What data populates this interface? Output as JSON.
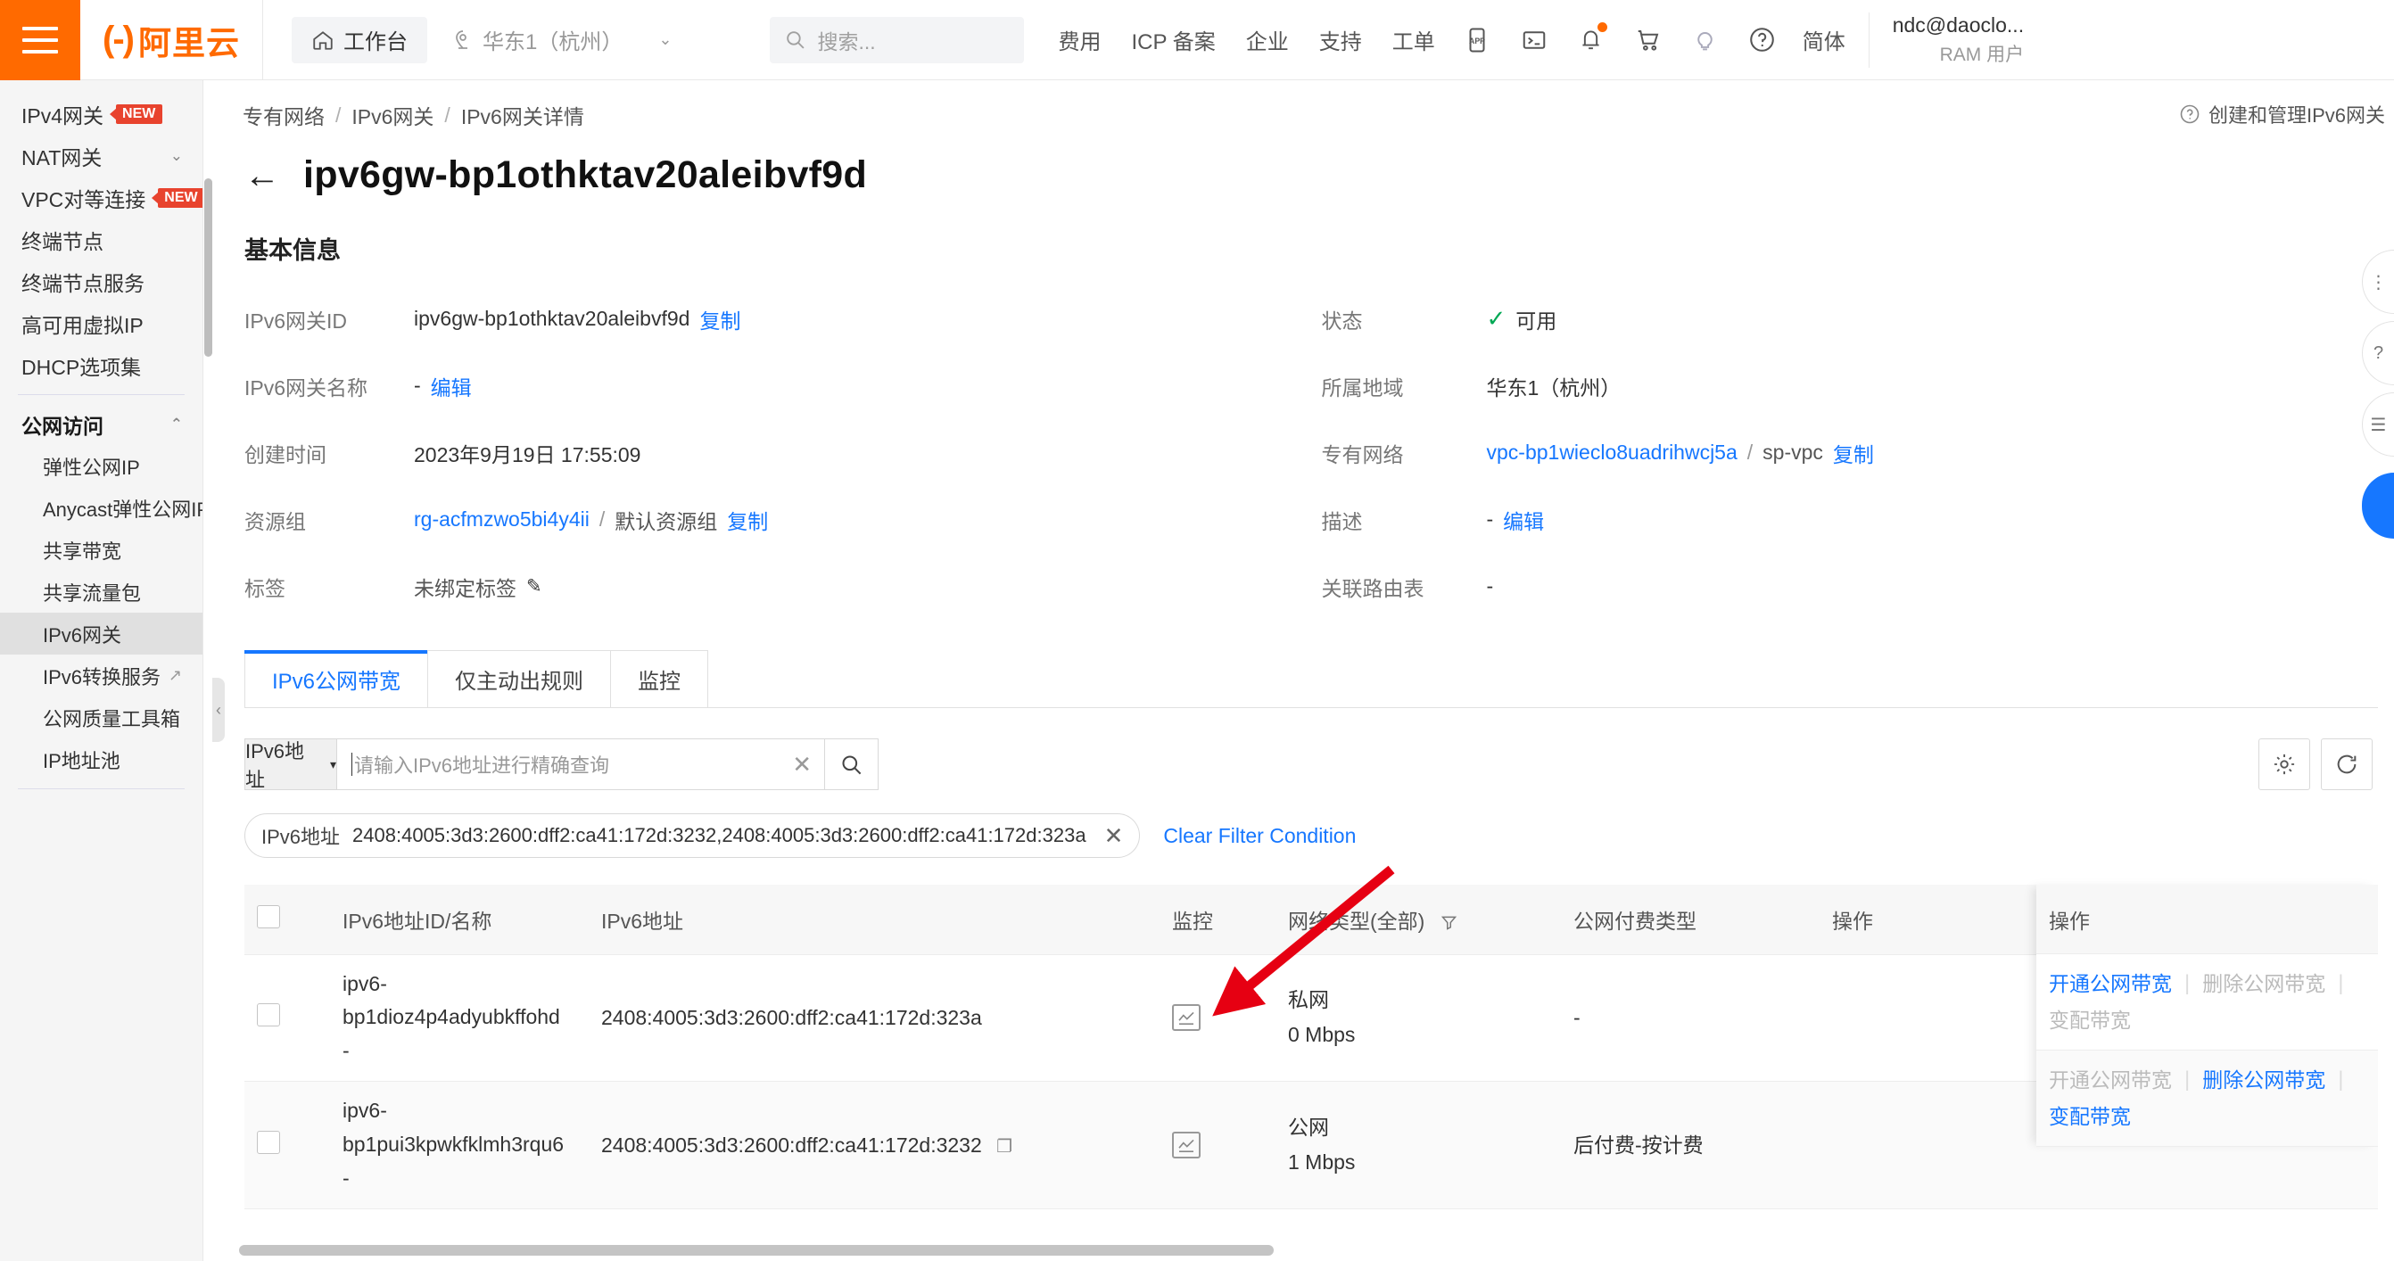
{
  "header": {
    "logo_text": "阿里云",
    "workbench": "工作台",
    "region": "华东1（杭州）",
    "search_placeholder": "搜索...",
    "nav_links": [
      "费用",
      "ICP 备案",
      "企业",
      "支持",
      "工单"
    ],
    "icons": [
      "app-icon",
      "terminal-icon",
      "bell-icon",
      "cart-icon",
      "lightbulb-icon",
      "help-icon"
    ],
    "lang": "简体",
    "user_name": "ndc@daoclo...",
    "user_role": "RAM 用户"
  },
  "sidebar": {
    "items": [
      {
        "label": "IPv4网关",
        "badge": "NEW",
        "level": "top"
      },
      {
        "label": "NAT网关",
        "chevron": "⌄",
        "level": "top"
      },
      {
        "label": "VPC对等连接",
        "badge": "NEW",
        "level": "top"
      },
      {
        "label": "终端节点",
        "level": "top"
      },
      {
        "label": "终端节点服务",
        "level": "top"
      },
      {
        "label": "高可用虚拟IP",
        "level": "top"
      },
      {
        "label": "DHCP选项集",
        "level": "top"
      },
      {
        "label": "公网访问",
        "level": "group",
        "chevron": "⌃"
      },
      {
        "label": "弹性公网IP",
        "level": "sub"
      },
      {
        "label": "Anycast弹性公网IP",
        "level": "sub"
      },
      {
        "label": "共享带宽",
        "level": "sub"
      },
      {
        "label": "共享流量包",
        "level": "sub"
      },
      {
        "label": "IPv6网关",
        "level": "sub",
        "active": true
      },
      {
        "label": "IPv6转换服务",
        "level": "sub",
        "external": true
      },
      {
        "label": "公网质量工具箱",
        "level": "sub"
      },
      {
        "label": "IP地址池",
        "level": "sub"
      }
    ]
  },
  "breadcrumb": {
    "items": [
      "专有网络",
      "IPv6网关",
      "IPv6网关详情"
    ],
    "separator": "/",
    "help_link": "创建和管理IPv6网关"
  },
  "page": {
    "title": "ipv6gw-bp1othktav20aleibvf9d",
    "back_icon": "back-arrow-icon",
    "section_title": "基本信息"
  },
  "basic_info": {
    "left": [
      {
        "label": "IPv6网关ID",
        "value": "ipv6gw-bp1othktav20aleibvf9d",
        "action": "复制"
      },
      {
        "label": "IPv6网关名称",
        "value": "-",
        "action": "编辑"
      },
      {
        "label": "创建时间",
        "value": "2023年9月19日 17:55:09"
      },
      {
        "label": "资源组",
        "value": "rg-acfmzwo5bi4y4ii",
        "sep": "/",
        "value2": "默认资源组",
        "action": "复制",
        "link": true
      },
      {
        "label": "标签",
        "value": "未绑定标签",
        "icon": "pencil-icon"
      }
    ],
    "right": [
      {
        "label": "状态",
        "value": "可用",
        "status_icon": "check-icon"
      },
      {
        "label": "所属地域",
        "value": "华东1（杭州）"
      },
      {
        "label": "专有网络",
        "value": "vpc-bp1wieclo8uadrihwcj5a",
        "sep": "/",
        "value2": "sp-vpc",
        "action": "复制",
        "link": true
      },
      {
        "label": "描述",
        "value": "-",
        "action": "编辑"
      },
      {
        "label": "关联路由表",
        "value": "-"
      }
    ]
  },
  "tabs": [
    {
      "label": "IPv6公网带宽",
      "active": true
    },
    {
      "label": "仅主动出规则",
      "active": false
    },
    {
      "label": "监控",
      "active": false
    }
  ],
  "search": {
    "select_label": "IPv6地址",
    "placeholder": "请输入IPv6地址进行精确查询",
    "value": "",
    "clear_icon": "close-icon",
    "search_icon": "search-icon",
    "settings_icon": "gear-icon",
    "refresh_icon": "refresh-icon"
  },
  "filter_chip": {
    "key": "IPv6地址",
    "value": "2408:4005:3d3:2600:dff2:ca41:172d:3232,2408:4005:3d3:2600:dff2:ca41:172d:323a",
    "remove_icon": "close-icon",
    "clear_all": "Clear Filter Condition"
  },
  "table": {
    "columns": [
      {
        "key": "checkbox",
        "label": ""
      },
      {
        "key": "id_name",
        "label": "IPv6地址ID/名称"
      },
      {
        "key": "ipv6",
        "label": "IPv6地址"
      },
      {
        "key": "monitor",
        "label": "监控"
      },
      {
        "key": "net_type",
        "label": "网络类型(全部)",
        "filter_icon": "filter-icon"
      },
      {
        "key": "billing",
        "label": "公网付费类型"
      },
      {
        "key": "actions",
        "label": "操作"
      }
    ],
    "rows": [
      {
        "id": "ipv6-bp1dioz4p4adyubkffohd",
        "name": "-",
        "ipv6": "2408:4005:3d3:2600:dff2:ca41:172d:323a",
        "copy": false,
        "monitor_icon": "chart-icon",
        "net_type": "私网",
        "bandwidth": "0 Mbps",
        "billing": "-",
        "actions": [
          {
            "label": "开通公网带宽",
            "enabled": true
          },
          {
            "label": "删除公网带宽",
            "enabled": false
          },
          {
            "label": "变配带宽",
            "enabled": false
          }
        ]
      },
      {
        "id": "ipv6-bp1pui3kpwkfklmh3rqu6",
        "name": "-",
        "ipv6": "2408:4005:3d3:2600:dff2:ca41:172d:3232",
        "copy": true,
        "monitor_icon": "chart-icon",
        "net_type": "公网",
        "bandwidth": "1 Mbps",
        "billing": "后付费-按计费",
        "actions": [
          {
            "label": "开通公网带宽",
            "enabled": false
          },
          {
            "label": "删除公网带宽",
            "enabled": true
          },
          {
            "label": "变配带宽",
            "enabled": true
          }
        ]
      }
    ]
  },
  "colors": {
    "brand_orange": "#FF6A00",
    "link_blue": "#1677ff",
    "success_green": "#00a854",
    "badge_red": "#e8432e",
    "annotation_red": "#e60012"
  }
}
